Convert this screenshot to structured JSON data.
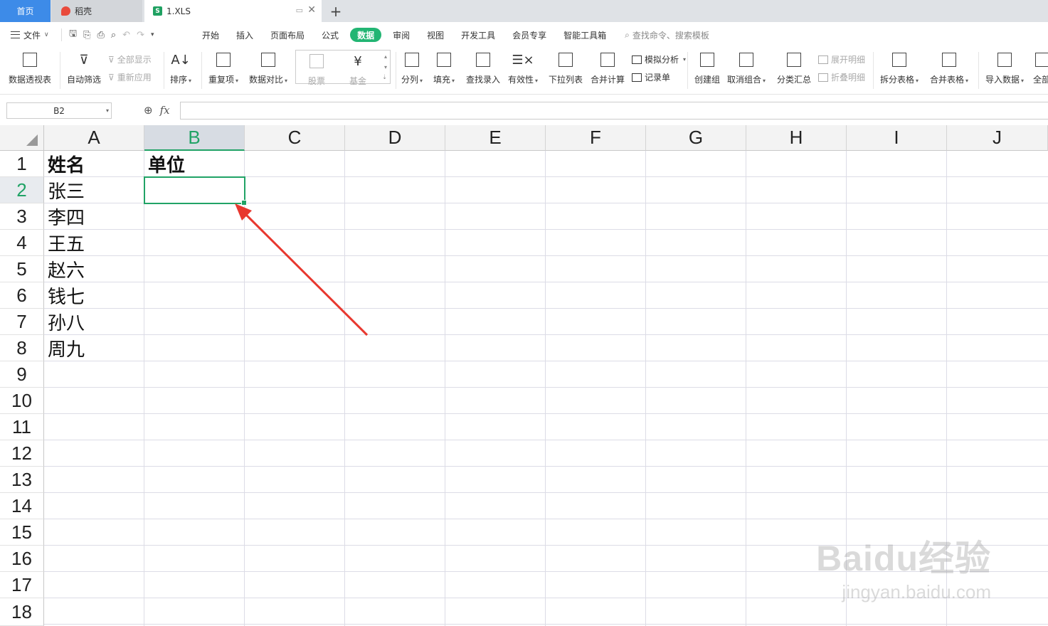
{
  "tabs": {
    "home": "首页",
    "daoke": "稻壳",
    "file": "1.XLS",
    "new_tab": "+"
  },
  "menu": {
    "file_label": "文件",
    "ribbon_tabs": [
      "开始",
      "插入",
      "页面布局",
      "公式",
      "数据",
      "审阅",
      "视图",
      "开发工具",
      "会员专享",
      "智能工具箱"
    ],
    "active_tab": "数据",
    "search_placeholder": "查找命令、搜索模板"
  },
  "ribbon": {
    "pivot": "数据透视表",
    "autofilter": "自动筛选",
    "show_all": "全部显示",
    "reapply": "重新应用",
    "sort": "排序",
    "duplicates": "重复项",
    "compare": "数据对比",
    "stock": "股票",
    "fund": "基金",
    "split_col": "分列",
    "fill": "填充",
    "lookup": "查找录入",
    "validity": "有效性",
    "dropdown": "下拉列表",
    "merge_calc": "合并计算",
    "simulate": "模拟分析",
    "record": "记录单",
    "create_group": "创建组",
    "ungroup": "取消组合",
    "subtotal": "分类汇总",
    "expand": "展开明细",
    "collapse": "折叠明细",
    "split_table": "拆分表格",
    "merge_table": "合并表格",
    "import": "导入数据",
    "more": "全部"
  },
  "formula_bar": {
    "name_box": "B2",
    "fx": "fx",
    "value": ""
  },
  "sheet": {
    "columns": [
      "A",
      "B",
      "C",
      "D",
      "E",
      "F",
      "G",
      "H",
      "I",
      "J"
    ],
    "selected_column": "B",
    "rows": [
      "1",
      "2",
      "3",
      "4",
      "5",
      "6",
      "7",
      "8",
      "9",
      "10",
      "11",
      "12",
      "13",
      "14",
      "15",
      "16",
      "17",
      "18"
    ],
    "selected_row": "2",
    "header_a": "姓名",
    "header_b": "单位",
    "names": [
      "张三",
      "李四",
      "王五",
      "赵六",
      "钱七",
      "孙八",
      "周九"
    ]
  },
  "accent_color": "#21a366",
  "arrow_color": "#e8382f",
  "watermark": {
    "logo": "Baidu经验",
    "url": "jingyan.baidu.com"
  }
}
